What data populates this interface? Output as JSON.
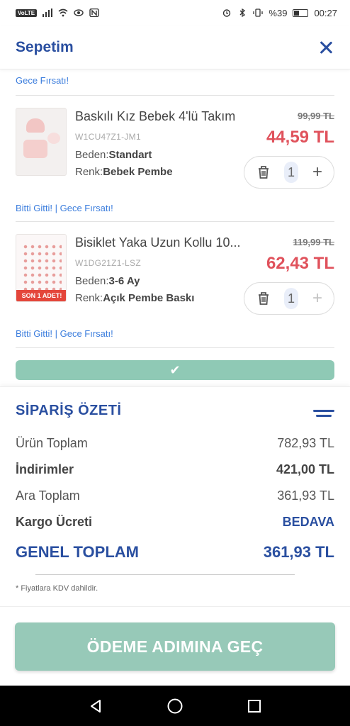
{
  "status_bar": {
    "network": "VoLTE",
    "battery_percent": "%39",
    "time": "00:27"
  },
  "header": {
    "title": "Sepetim"
  },
  "top_tag": "Gece Fırsatı!",
  "items": [
    {
      "title": "Baskılı Kız Bebek 4'lü Takım",
      "sku": "W1CU47Z1-JM1",
      "size_label": "Beden:",
      "size_value": "Standart",
      "color_label": "Renk:",
      "color_value": "Bebek Pembe",
      "old_price": "99,99 TL",
      "new_price": "44,59 TL",
      "quantity": "1",
      "tags": "Bitti Gitti! | Gece Fırsatı!",
      "badge": ""
    },
    {
      "title": "Bisiklet Yaka Uzun Kollu 10...",
      "sku": "W1DG21Z1-LSZ",
      "size_label": "Beden:",
      "size_value": "3-6 Ay",
      "color_label": "Renk:",
      "color_value": "Açık Pembe Baskı",
      "old_price": "119,99 TL",
      "new_price": "62,43 TL",
      "quantity": "1",
      "tags": "Bitti Gitti! | Gece Fırsatı!",
      "badge": "SON 1 ADET!"
    }
  ],
  "summary": {
    "title": "SİPARİŞ ÖZETİ",
    "rows": [
      {
        "label": "Ürün Toplam",
        "value": "782,93 TL"
      },
      {
        "label": "İndirimler",
        "value": "421,00 TL"
      },
      {
        "label": "Ara Toplam",
        "value": "361,93 TL"
      },
      {
        "label": "Kargo Ücreti",
        "value": "BEDAVA"
      }
    ],
    "total_label": "GENEL TOPLAM",
    "total_value": "361,93 TL",
    "vat_note": "* Fiyatlara KDV dahildir."
  },
  "checkout": {
    "label": "ÖDEME ADIMINA GEÇ"
  },
  "colors": {
    "brand_blue": "#2a4fa0",
    "price_red": "#e0525c",
    "cta_green": "#97c9b8",
    "link_blue": "#3b7ddd"
  }
}
